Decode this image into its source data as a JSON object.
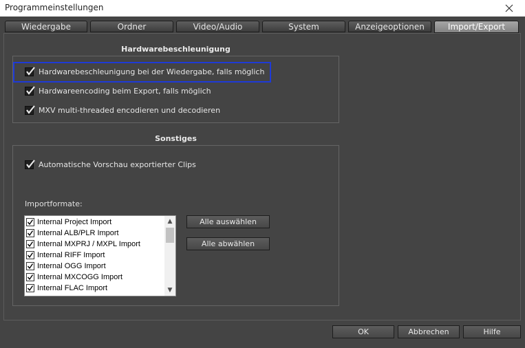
{
  "window": {
    "title": "Programmeinstellungen"
  },
  "tabs": [
    {
      "label": "Wiedergabe",
      "active": false
    },
    {
      "label": "Ordner",
      "active": false
    },
    {
      "label": "Video/Audio",
      "active": false
    },
    {
      "label": "System",
      "active": false
    },
    {
      "label": "Anzeigeoptionen",
      "active": false
    },
    {
      "label": "Import/Export",
      "active": true
    }
  ],
  "hardware": {
    "title": "Hardwarebeschleunigung",
    "options": [
      {
        "label": "Hardwarebeschleunigung bei der Wiedergabe, falls möglich",
        "checked": true
      },
      {
        "label": "Hardwareencoding beim Export, falls möglich",
        "checked": true
      },
      {
        "label": "MXV multi-threaded encodieren und decodieren",
        "checked": true
      }
    ]
  },
  "misc": {
    "title": "Sonstiges",
    "auto_preview": {
      "label": "Automatische Vorschau exportierter Clips",
      "checked": true
    },
    "import_formats_label": "Importformate:",
    "import_formats": [
      {
        "label": "Internal Project Import",
        "checked": true
      },
      {
        "label": "Internal ALB/PLR Import",
        "checked": true
      },
      {
        "label": "Internal MXPRJ / MXPL Import",
        "checked": true
      },
      {
        "label": "Internal RIFF Import",
        "checked": true
      },
      {
        "label": "Internal OGG Import",
        "checked": true
      },
      {
        "label": "Internal MXCOGG Import",
        "checked": true
      },
      {
        "label": "Internal FLAC Import",
        "checked": true
      }
    ],
    "select_all": "Alle auswählen",
    "deselect_all": "Alle abwählen"
  },
  "footer": {
    "ok": "OK",
    "cancel": "Abbrechen",
    "help": "Hilfe"
  },
  "colors": {
    "highlight": "#1e3ad8",
    "background": "#444444"
  }
}
